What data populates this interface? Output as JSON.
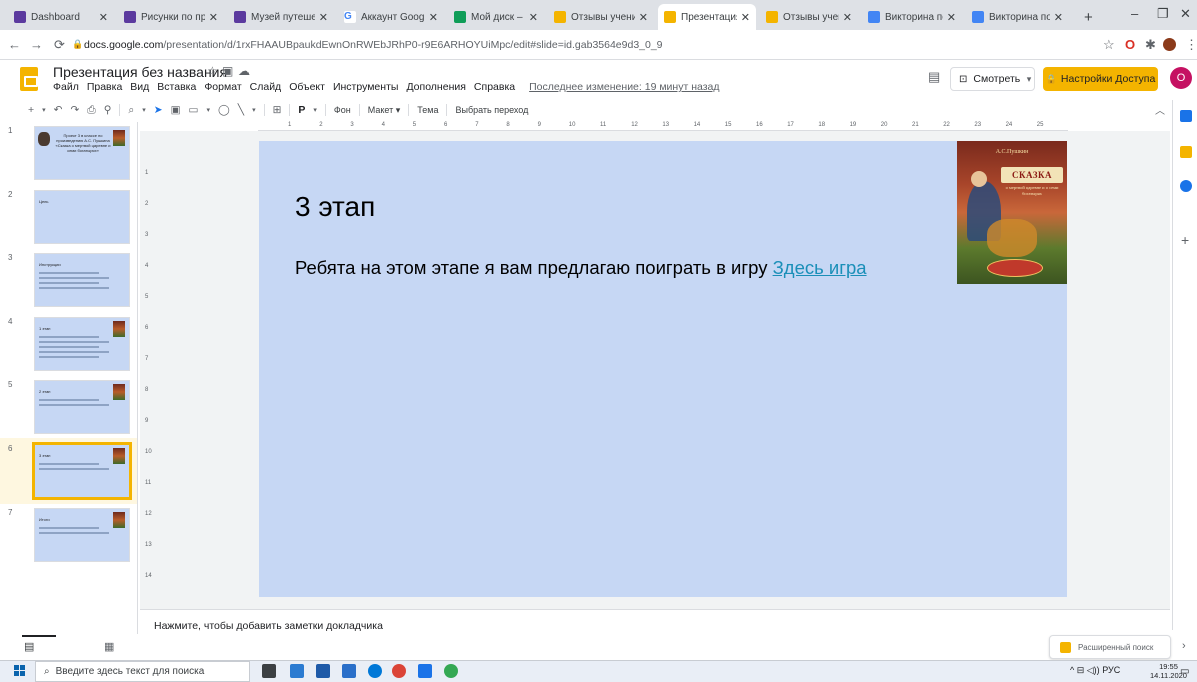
{
  "browser": {
    "tabs": [
      {
        "label": "Dashboard",
        "color": "#5b3a9e"
      },
      {
        "label": "Рисунки по произ",
        "color": "#5b3a9e"
      },
      {
        "label": "Музей путешестви",
        "color": "#5b3a9e"
      },
      {
        "label": "Аккаунт Google",
        "color": "#4285f4",
        "glyph": "G"
      },
      {
        "label": "Мой диск – Google",
        "color": "#0f9d58"
      },
      {
        "label": "Отзывы учеников",
        "color": "#f4b400"
      },
      {
        "label": "Презентация без н",
        "color": "#f4b400",
        "active": true
      },
      {
        "label": "Отзывы учеников",
        "color": "#f4b400"
      },
      {
        "label": "Викторина по сказ",
        "color": "#4285f4"
      },
      {
        "label": "Викторина по сказ",
        "color": "#4285f4"
      }
    ],
    "new_tab": "+",
    "url_host": "docs.google.com",
    "url_path": "/presentation/d/1rxFHAAUBpaukdEwnOnRWEbJRhP0-r9E6ARHOYUiMpc/edit#slide=id.gab3564e9d3_0_9"
  },
  "docs": {
    "title": "Презентация без названия",
    "menu": [
      "Файл",
      "Правка",
      "Вид",
      "Вставка",
      "Формат",
      "Слайд",
      "Объект",
      "Инструменты",
      "Дополнения",
      "Справка"
    ],
    "last_edit": "Последнее изменение: 19 минут назад",
    "present_label": "Смотреть",
    "share_label": "Настройки Доступа",
    "avatar_letter": "О",
    "brand_color": "#f4b400"
  },
  "toolbar": {
    "bg_label": "Фон",
    "layout_label": "Макет",
    "theme_label": "Тема",
    "transition_label": "Выбрать переход"
  },
  "filmstrip": [
    {
      "num": "1",
      "kind": "title",
      "title": "Проект 3 в классе по произведению А.С. Пушкина «Сказка о мертвой царевне и семи богатырях»"
    },
    {
      "num": "2",
      "kind": "plain",
      "title": "Цель"
    },
    {
      "num": "3",
      "kind": "lines",
      "title": "Инструкции"
    },
    {
      "num": "4",
      "kind": "img",
      "title": "1 этап"
    },
    {
      "num": "5",
      "kind": "img",
      "title": "2 этап"
    },
    {
      "num": "6",
      "kind": "img",
      "title": "3 этап",
      "selected": true
    },
    {
      "num": "7",
      "kind": "img",
      "title": "Итоги"
    }
  ],
  "ruler_top": [
    "1",
    "2",
    "3",
    "4",
    "5",
    "6",
    "7",
    "8",
    "9",
    "10",
    "11",
    "12",
    "13",
    "14",
    "15",
    "16",
    "17",
    "18",
    "19",
    "20",
    "21",
    "22",
    "23",
    "24",
    "25"
  ],
  "ruler_left": [
    "1",
    "2",
    "3",
    "4",
    "5",
    "6",
    "7",
    "8",
    "9",
    "10",
    "11",
    "12",
    "13",
    "14"
  ],
  "slide": {
    "title": "3 этап",
    "body_text": "Ребята на этом этапе я вам предлагаю поиграть в игру ",
    "link_text": "Здесь игра",
    "background": "#c6d7f4",
    "book": {
      "author": "А.С.Пушкин",
      "title": "СКАЗКА",
      "subtitle": "о мертвой царевне и о семи богатырях"
    }
  },
  "notes_placeholder": "Нажмите, чтобы добавить заметки докладчика",
  "explore_label": "Расширенный поиск",
  "taskbar": {
    "search_placeholder": "Введите здесь текст для поиска",
    "lang": "РУС",
    "time": "19:55",
    "date": "14.11.2020"
  }
}
